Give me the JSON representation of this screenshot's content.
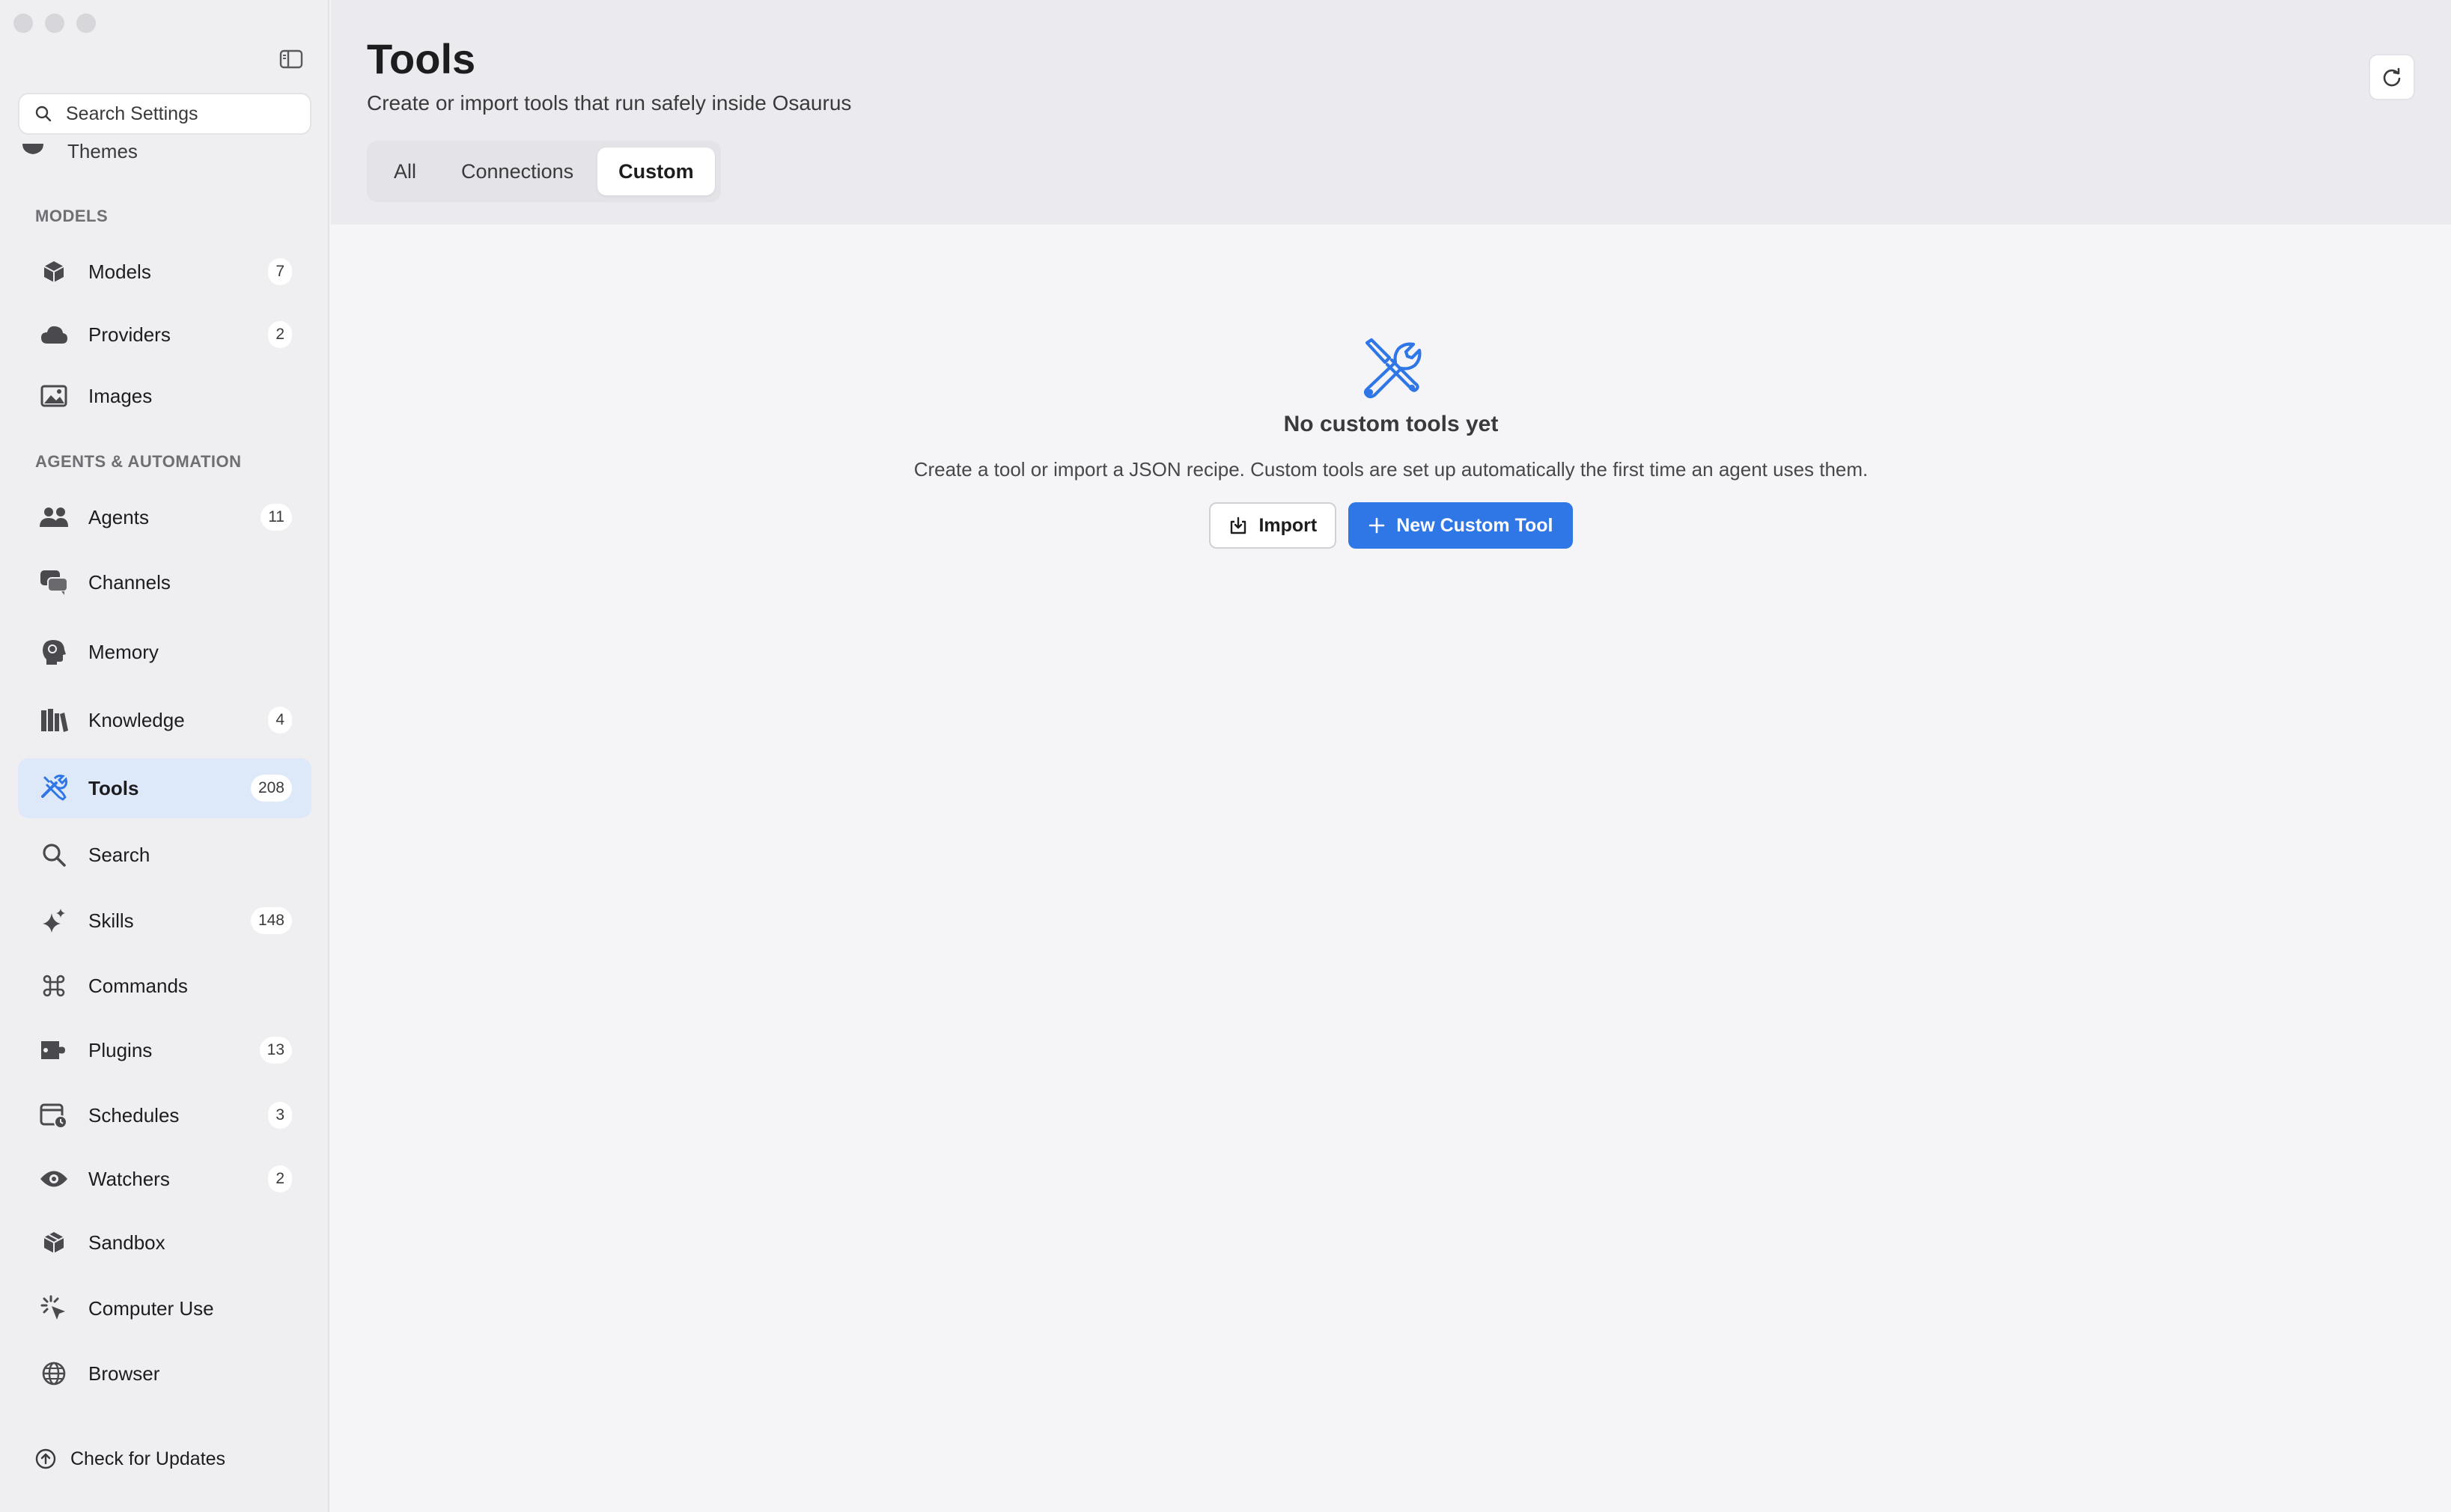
{
  "sidebar": {
    "search_placeholder": "Search Settings",
    "partial_item": "Themes",
    "sections": {
      "models": "MODELS",
      "agents": "AGENTS & AUTOMATION"
    },
    "items": [
      {
        "label": "Models",
        "badge": "7"
      },
      {
        "label": "Providers",
        "badge": "2"
      },
      {
        "label": "Images",
        "badge": ""
      },
      {
        "label": "Agents",
        "badge": "11"
      },
      {
        "label": "Channels",
        "badge": ""
      },
      {
        "label": "Memory",
        "badge": ""
      },
      {
        "label": "Knowledge",
        "badge": "4"
      },
      {
        "label": "Tools",
        "badge": "208"
      },
      {
        "label": "Search",
        "badge": ""
      },
      {
        "label": "Skills",
        "badge": "148"
      },
      {
        "label": "Commands",
        "badge": ""
      },
      {
        "label": "Plugins",
        "badge": "13"
      },
      {
        "label": "Schedules",
        "badge": "3"
      },
      {
        "label": "Watchers",
        "badge": "2"
      },
      {
        "label": "Sandbox",
        "badge": ""
      },
      {
        "label": "Computer Use",
        "badge": ""
      },
      {
        "label": "Browser",
        "badge": ""
      }
    ],
    "active_item": "Tools",
    "check_updates": "Check for Updates"
  },
  "header": {
    "title": "Tools",
    "subtitle": "Create or import tools that run safely inside Osaurus",
    "tabs": [
      "All",
      "Connections",
      "Custom"
    ],
    "active_tab": "Custom"
  },
  "empty_state": {
    "icon": "wrench-screwdriver-icon",
    "title": "No custom tools yet",
    "description": "Create a tool or import a JSON recipe. Custom tools are set up automatically the first time an agent uses them.",
    "import_label": "Import",
    "new_label": "New Custom Tool"
  },
  "colors": {
    "accent": "#2f76e6",
    "active_bg": "#dde8f8",
    "sidebar_bg": "#efeff2"
  }
}
